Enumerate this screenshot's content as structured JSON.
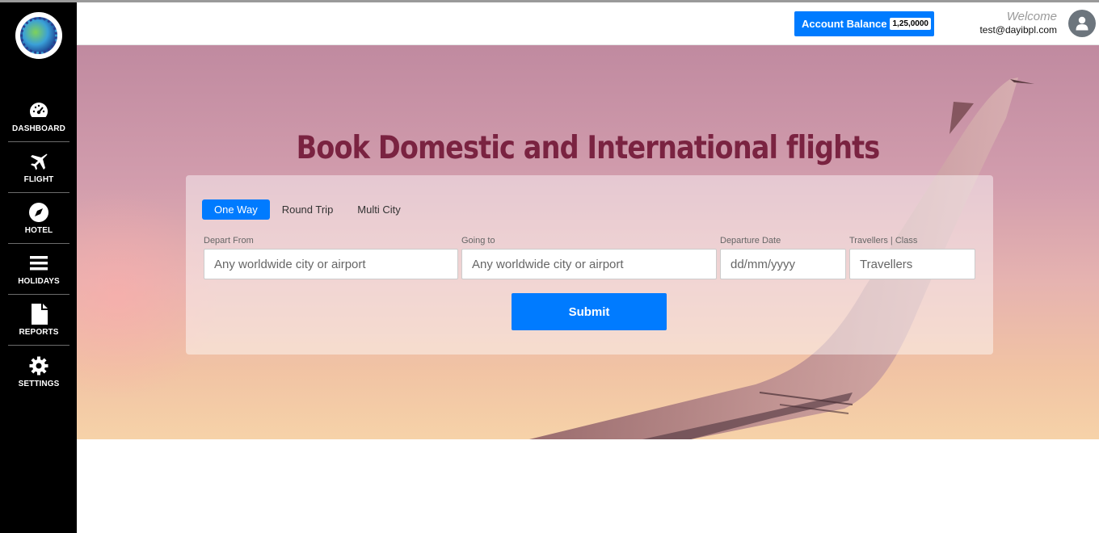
{
  "sidebar": {
    "logo": "company-logo",
    "items": [
      {
        "label": "DASHBOARD",
        "icon": "dashboard-icon"
      },
      {
        "label": "FLIGHT",
        "icon": "plane-icon"
      },
      {
        "label": "HOTEL",
        "icon": "compass-icon"
      },
      {
        "label": "HOLIDAYS",
        "icon": "bars-icon"
      },
      {
        "label": "REPORTS",
        "icon": "file-icon"
      },
      {
        "label": "SETTINGS",
        "icon": "gear-icon"
      }
    ]
  },
  "header": {
    "balance_label": "Account Balance",
    "balance_value": "1,25,0000",
    "welcome_label": "Welcome",
    "user_email": "test@dayibpl.com",
    "avatar_icon": "user-icon"
  },
  "hero": {
    "title": "Book Domestic and International flights"
  },
  "search": {
    "tabs": [
      {
        "label": "One Way",
        "active": true
      },
      {
        "label": "Round Trip",
        "active": false
      },
      {
        "label": "Multi City",
        "active": false
      }
    ],
    "fields": {
      "from": {
        "label": "Depart From",
        "placeholder": "Any worldwide city or airport"
      },
      "to": {
        "label": "Going to",
        "placeholder": "Any worldwide city or airport"
      },
      "date": {
        "label": "Departure Date",
        "placeholder": "dd/mm/yyyy"
      },
      "travellers": {
        "label": "Travellers | Class",
        "placeholder": "Travellers"
      }
    },
    "submit_label": "Submit"
  },
  "colors": {
    "accent": "#007bff",
    "sidebar_bg": "#000000",
    "title": "#7a2341"
  }
}
